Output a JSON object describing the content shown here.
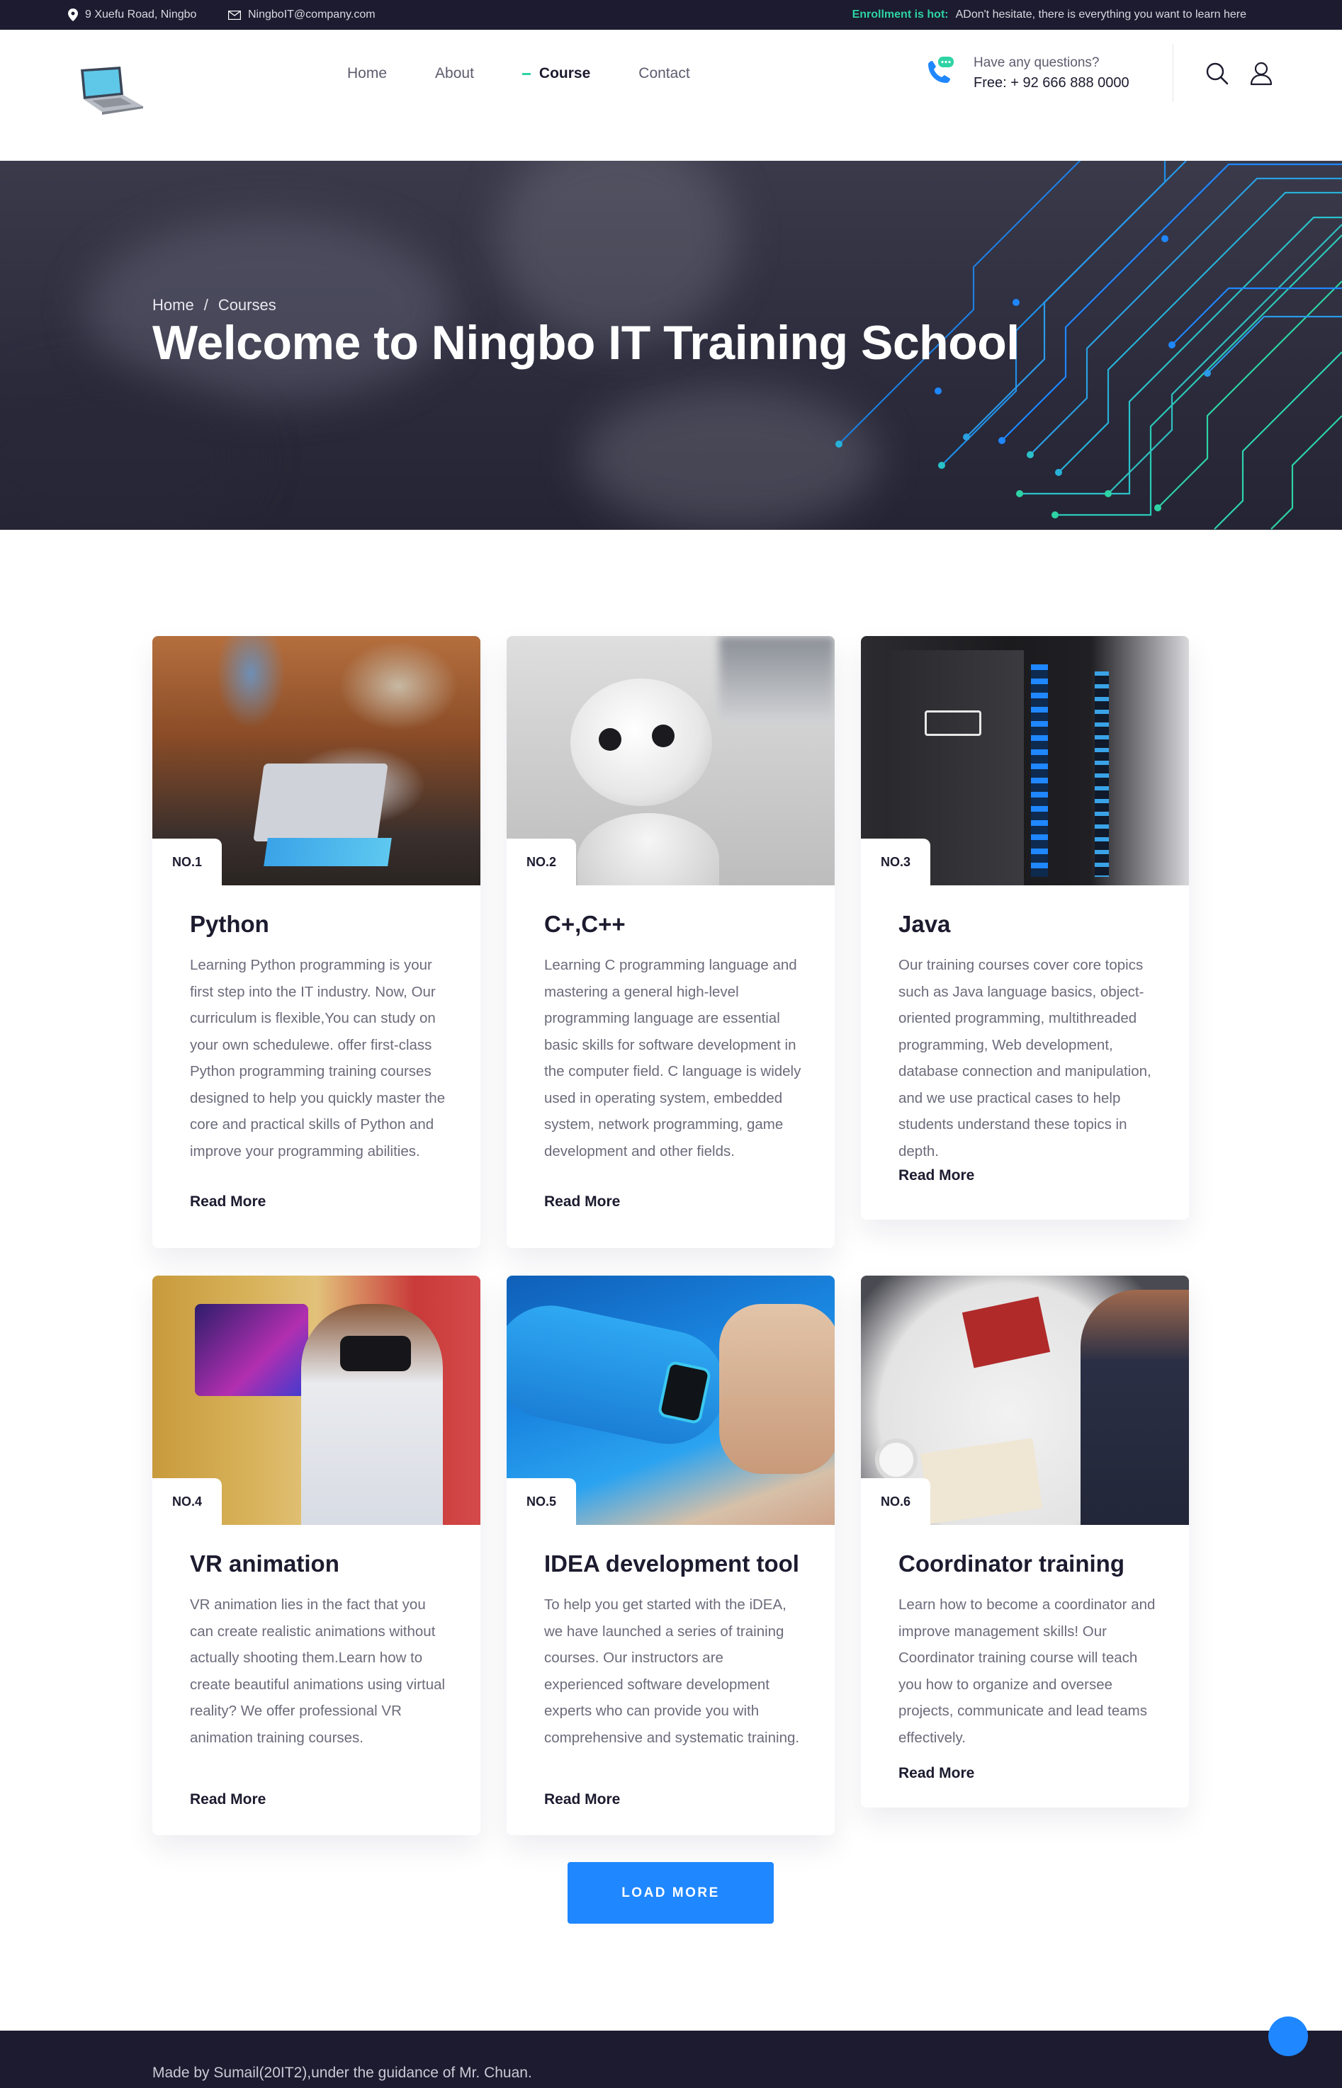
{
  "topbar": {
    "address": "9 Xuefu Road, Ningbo",
    "email": "NingboIT@company.com",
    "notice_hot": "Enrollment is hot:",
    "notice_text": "ADon't hesitate, there is everything you want to learn here"
  },
  "nav": {
    "items": [
      {
        "label": "Home",
        "active": false
      },
      {
        "label": "About",
        "active": false
      },
      {
        "label": "Course",
        "active": true
      },
      {
        "label": "Contact",
        "active": false
      }
    ]
  },
  "contact": {
    "question": "Have any questions?",
    "phone": "Free: + 92 666 888 0000"
  },
  "hero": {
    "breadcrumb": [
      "Home",
      "/",
      "Courses"
    ],
    "title": "Welcome to Ningbo IT Training School"
  },
  "courses": [
    {
      "badge": "NO.1",
      "title": "Python",
      "description": "Learning Python programming is your first step into the IT industry. Now, Our curriculum is flexible,You can study on your own schedulewe. offer first-class Python programming training courses designed to help you quickly master the core and practical skills of Python and improve your programming abilities.",
      "link": "Read More"
    },
    {
      "badge": "NO.2",
      "title": "C+,C++",
      "description": "Learning C programming language and mastering a general high-level programming language are essential basic skills for software development in the computer field. C language is widely used in operating system, embedded system, network programming, game development and other fields.",
      "link": "Read More"
    },
    {
      "badge": "NO.3",
      "title": "Java",
      "description": "Our training courses cover core topics such as Java language basics, object-oriented programming, multithreaded programming, Web development, database connection and manipulation, and we use practical cases to help students understand these topics in depth.",
      "link": "Read More"
    },
    {
      "badge": "NO.4",
      "title": "VR animation",
      "description": "VR animation lies in the fact that you can create realistic animations without actually shooting them.Learn how to create beautiful animations using virtual reality? We offer professional VR animation training courses.",
      "link": "Read More"
    },
    {
      "badge": "NO.5",
      "title": "IDEA development tool",
      "description": "To help you get started with the iDEA, we have launched a series of training courses. Our instructors are experienced software development experts who can provide you with comprehensive and systematic training.",
      "link": "Read More"
    },
    {
      "badge": "NO.6",
      "title": "Coordinator training",
      "description": "Learn how to become a coordinator and improve management skills! Our Coordinator training course will teach you how to organize and oversee projects, communicate and lead teams effectively.",
      "link": "Read More"
    }
  ],
  "load_more": "LOAD MORE",
  "footer": {
    "credit": "Made by Sumail(20IT2),under the guidance of Mr. Chuan."
  },
  "icons": {
    "location": "location-pin-icon",
    "mail": "envelope-icon",
    "phone": "phone-chat-icon",
    "search": "search-icon",
    "user": "user-icon",
    "logo": "laptop-logo-icon"
  },
  "colors": {
    "dark": "#1c1b2f",
    "accent": "#2ed3a4",
    "primary": "#1f87ff",
    "text_muted": "#6b6b7b"
  }
}
